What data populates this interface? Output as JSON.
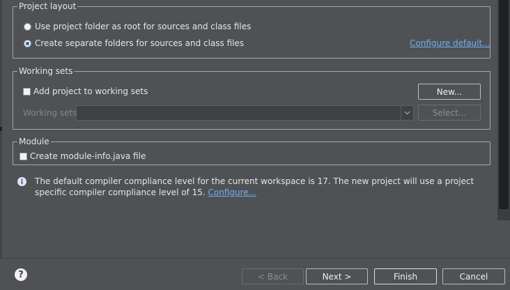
{
  "project_layout": {
    "legend": "Project layout",
    "option_root": "Use project folder as root for sources and class files",
    "option_separate": "Create separate folders for sources and class files",
    "selected": "separate",
    "configure_default_link": "Configure default..."
  },
  "working_sets": {
    "legend": "Working sets",
    "add_checkbox_label": "Add project to working sets",
    "add_checked": false,
    "new_button": "New...",
    "working_sets_label": "Working sets:",
    "working_sets_value": "",
    "select_button": "Select..."
  },
  "module": {
    "legend": "Module",
    "create_module_info_label": "Create module-info.java file",
    "create_checked": false
  },
  "info": {
    "message": "The default compiler compliance level for the current workspace is 17. The new project will use a project specific compiler compliance level of 15.",
    "configure_link": "Configure..."
  },
  "footer": {
    "back_button": "< Back",
    "next_button": "Next >",
    "finish_button": "Finish",
    "cancel_button": "Cancel"
  },
  "icons": {
    "info": "info-icon",
    "help": "help-icon",
    "dropdown": "chevron-down-icon"
  },
  "colors": {
    "background": "#4f5154",
    "link": "#6fb0f0",
    "radio_selected": "#1f62c4"
  }
}
